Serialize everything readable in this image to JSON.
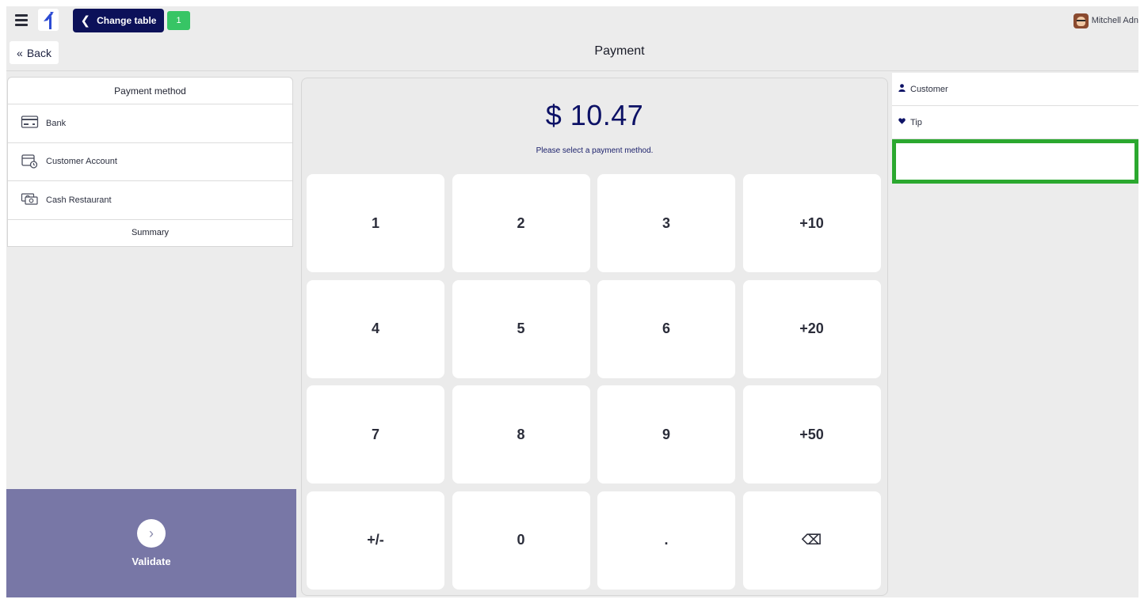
{
  "topbar": {
    "change_table_label": "Change table",
    "order_count": "1",
    "user_name": "Mitchell Adn"
  },
  "header": {
    "back_label": "Back",
    "title": "Payment"
  },
  "payment_methods": {
    "heading": "Payment method",
    "items": [
      {
        "label": "Bank",
        "icon": "bank-card-icon"
      },
      {
        "label": "Customer Account",
        "icon": "customer-account-icon"
      },
      {
        "label": "Cash Restaurant",
        "icon": "cash-icon"
      }
    ],
    "summary_label": "Summary"
  },
  "payment": {
    "amount": "$ 10.47",
    "prompt": "Please select a payment method."
  },
  "keypad": {
    "keys": [
      "1",
      "2",
      "3",
      "+10",
      "4",
      "5",
      "6",
      "+20",
      "7",
      "8",
      "9",
      "+50",
      "+/-",
      "0",
      ".",
      "⌫"
    ]
  },
  "validate": {
    "label": "Validate"
  },
  "right_panel": {
    "customer_label": "Customer",
    "tip_label": "Tip"
  },
  "colors": {
    "primary": "#0c1159",
    "badge": "#37c565",
    "validate_bg": "#7877a6",
    "highlight": "#2ba82f"
  }
}
